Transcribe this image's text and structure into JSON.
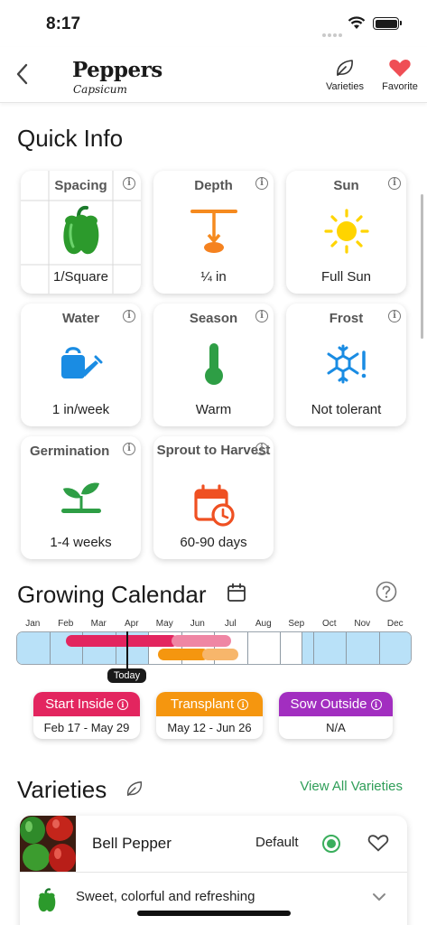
{
  "status_bar": {
    "time": "8:17"
  },
  "nav": {
    "title": "Peppers",
    "subtitle": "Capsicum",
    "varieties_label": "Varieties",
    "favorite_label": "Favorite"
  },
  "quick_info": {
    "heading": "Quick Info",
    "cards": [
      {
        "label": "Spacing",
        "value": "1/Square",
        "icon": "pepper-grid-icon"
      },
      {
        "label": "Depth",
        "value": "¼ in",
        "icon": "seed-depth-icon"
      },
      {
        "label": "Sun",
        "value": "Full Sun",
        "icon": "sun-icon"
      },
      {
        "label": "Water",
        "value": "1 in/week",
        "icon": "watering-can-icon"
      },
      {
        "label": "Season",
        "value": "Warm",
        "icon": "thermometer-icon"
      },
      {
        "label": "Frost",
        "value": "Not tolerant",
        "icon": "snowflake-alert-icon"
      },
      {
        "label": "Germination",
        "value": "1-4 weeks",
        "icon": "sprout-icon"
      },
      {
        "label": "Sprout to Harvest",
        "value": "60-90 days",
        "icon": "calendar-clock-icon"
      }
    ]
  },
  "calendar": {
    "heading": "Growing Calendar",
    "months": [
      "Jan",
      "Feb",
      "Mar",
      "Apr",
      "May",
      "Jun",
      "Jul",
      "Aug",
      "Sep",
      "Oct",
      "Nov",
      "Dec"
    ],
    "today_label": "Today",
    "legend": [
      {
        "title": "Start Inside",
        "dates": "Feb 17 - May 29",
        "color": "#e3255f"
      },
      {
        "title": "Transplant",
        "dates": "May 12 - Jun 26",
        "color": "#f5960f"
      },
      {
        "title": "Sow Outside",
        "dates": "N/A",
        "color": "#a22ec0"
      }
    ],
    "colors": {
      "frost": "#b9e1f8",
      "inside": "#e3255f",
      "inside_light": "#ef86a4",
      "transplant": "#f5960f",
      "transplant_light": "#f7b66b"
    }
  },
  "varieties": {
    "heading": "Varieties",
    "view_all": "View All Varieties",
    "items": [
      {
        "name": "Bell Pepper",
        "badge": "Default",
        "description": "Sweet, colorful and refreshing"
      }
    ]
  },
  "accent_color": "#2f9e58"
}
